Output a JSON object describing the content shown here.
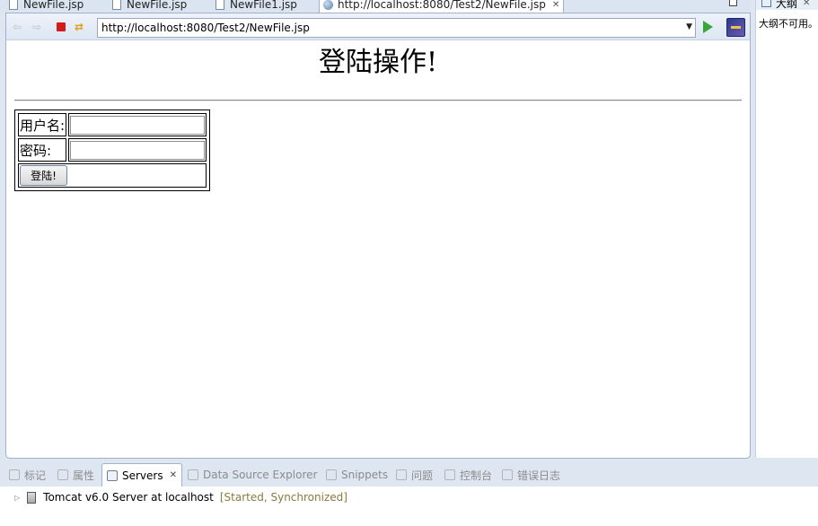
{
  "editor_tabs": [
    {
      "label": "NewFile.jsp",
      "active": false
    },
    {
      "label": "NewFile.jsp",
      "active": false
    },
    {
      "label": "NewFile1.jsp",
      "active": false
    },
    {
      "label": "http://localhost:8080/Test2/NewFile.jsp",
      "active": true
    }
  ],
  "browser": {
    "url": "http://localhost:8080/Test2/NewFile.jsp"
  },
  "page": {
    "heading": "登陆操作!",
    "username_label": "用户名:",
    "username_value": "",
    "password_label": "密码:",
    "password_value": "",
    "submit_label": "登陆!"
  },
  "outline": {
    "tab_label": "大纲",
    "message": "大纲不可用。"
  },
  "bottom_tabs": [
    {
      "label": "标记",
      "active": false
    },
    {
      "label": "属性",
      "active": false
    },
    {
      "label": "Servers",
      "active": true
    },
    {
      "label": "Data Source Explorer",
      "active": false
    },
    {
      "label": "Snippets",
      "active": false
    },
    {
      "label": "问题",
      "active": false
    },
    {
      "label": "控制台",
      "active": false
    },
    {
      "label": "错误日志",
      "active": false
    }
  ],
  "servers": [
    {
      "name": "Tomcat v6.0 Server at localhost",
      "status": "[Started, Synchronized]"
    }
  ],
  "icons": {
    "close": "close-icon",
    "back": "back-arrow-icon",
    "forward": "forward-arrow-icon",
    "stop": "stop-icon",
    "refresh": "refresh-icon",
    "go": "go-icon",
    "eclipse": "eclipse-icon",
    "expand": "expand-triangle-icon"
  },
  "colors": {
    "chrome_background": "#dde6f1",
    "stop_red": "#d41b1b",
    "go_green": "#3aa53a",
    "server_status": "#8a7a3d"
  }
}
